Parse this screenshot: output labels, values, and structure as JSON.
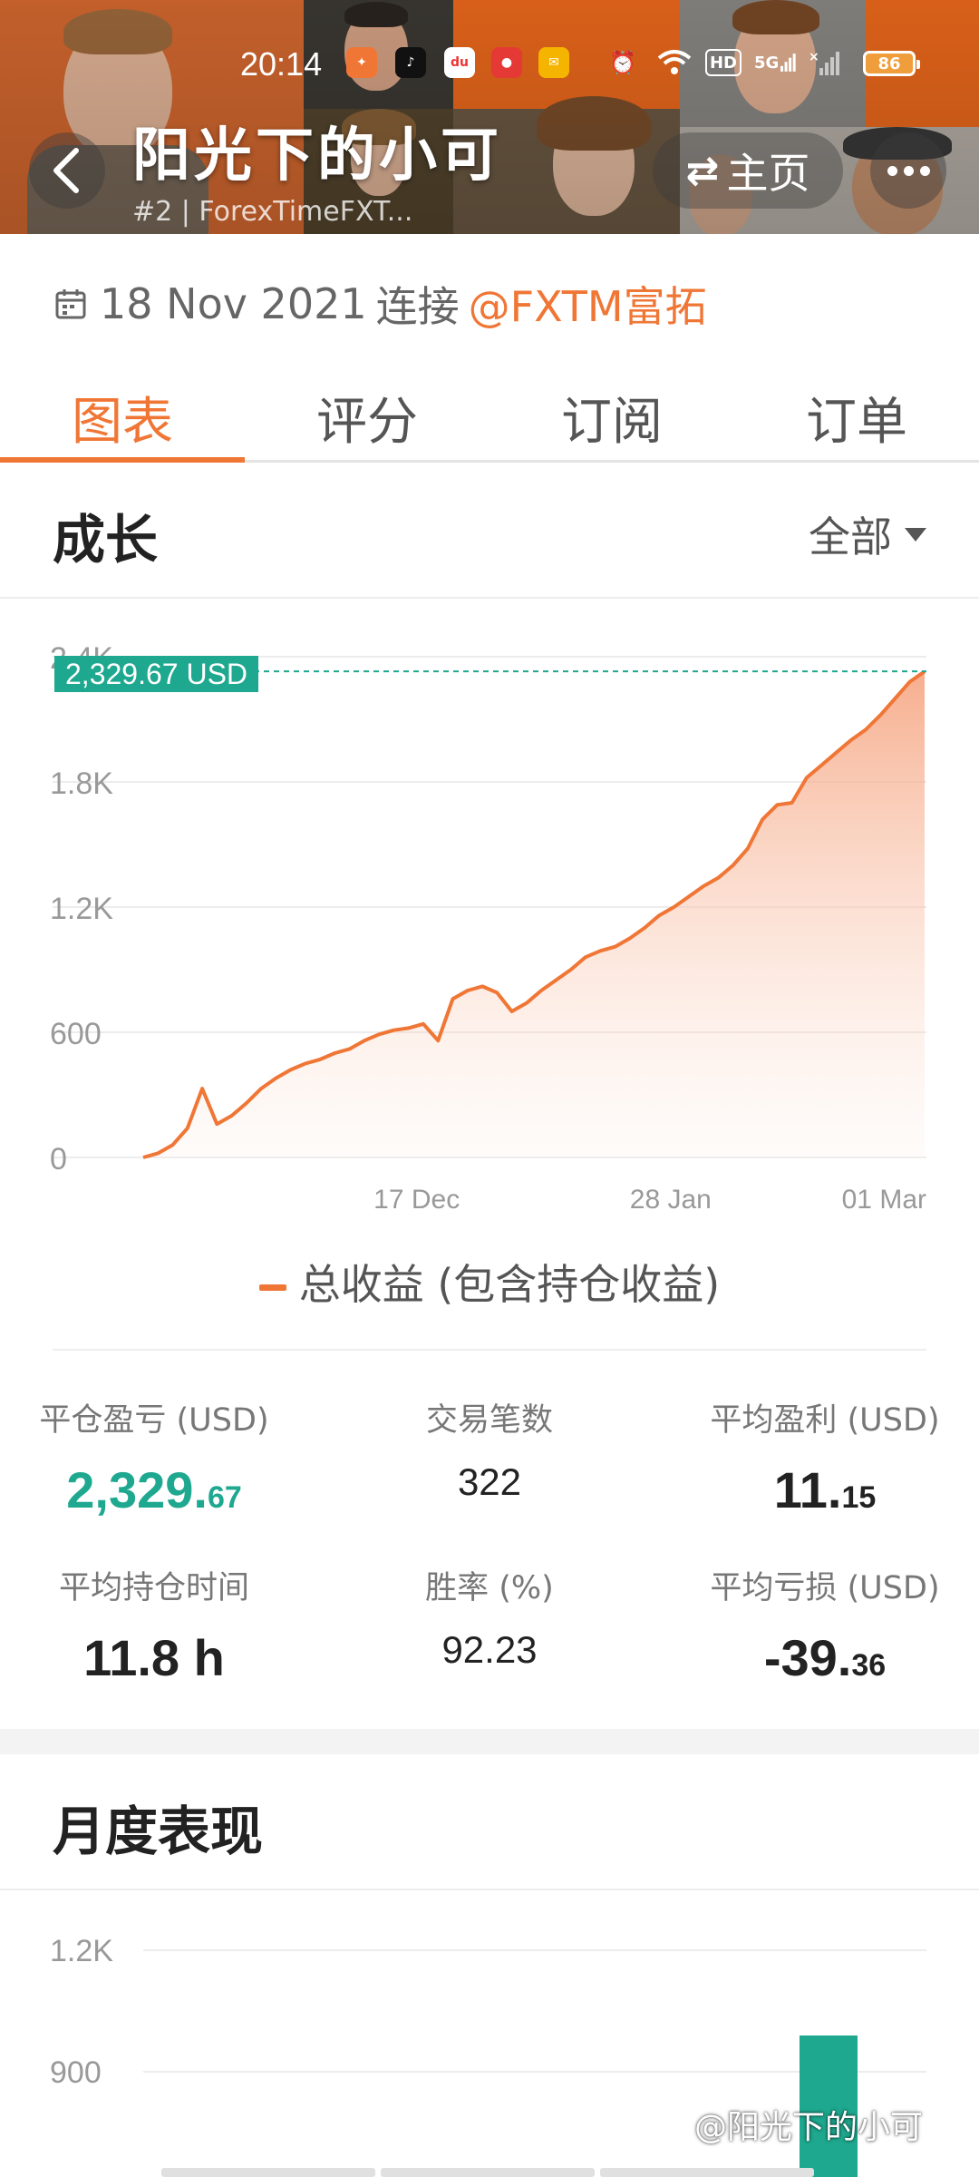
{
  "status_bar": {
    "time": "20:14",
    "network": "5G",
    "hd": "HD",
    "battery": "86"
  },
  "header": {
    "title": "阳光下的小可",
    "subtitle": "#2 | ForexTimeFXT...",
    "home_label": "主页",
    "back_icon": "chevron-left-icon",
    "more_icon": "more-dots-icon"
  },
  "connect": {
    "date": "18 Nov 2021",
    "verb": "连接",
    "broker": "@FXTM富拓"
  },
  "tabs": [
    {
      "label": "图表",
      "active": true
    },
    {
      "label": "评分",
      "active": false
    },
    {
      "label": "订阅",
      "active": false
    },
    {
      "label": "订单",
      "active": false
    }
  ],
  "growth": {
    "title": "成长",
    "range": "全部",
    "current_label": "2,329.67 USD",
    "legend": "总收益 (包含持仓收益)"
  },
  "stats": {
    "closed_pnl": {
      "label": "平仓盈亏 (USD)",
      "int": "2,329.",
      "dec": "67"
    },
    "trades": {
      "label": "交易笔数",
      "value": "322"
    },
    "avg_profit": {
      "label": "平均盈利 (USD)",
      "int": "11.",
      "dec": "15"
    },
    "avg_hold": {
      "label": "平均持仓时间",
      "value": "11.8 h"
    },
    "win_rate": {
      "label": "胜率 (%)",
      "value": "92.23"
    },
    "avg_loss": {
      "label": "平均亏损 (USD)",
      "int": "-39.",
      "dec": "36"
    }
  },
  "monthly": {
    "title": "月度表现"
  },
  "watermark": "@阳光下的小可",
  "colors": {
    "accent": "#f07636",
    "positive": "#1ea88f",
    "text": "#222222"
  },
  "chart_data": [
    {
      "type": "area",
      "title": "",
      "x_labels": [
        "17 Dec",
        "28 Jan",
        "01 Mar"
      ],
      "y_ticks": [
        "0",
        "600",
        "1.2K",
        "1.8K",
        "2.4K"
      ],
      "ylim": [
        0,
        2400
      ],
      "grid": true,
      "legend_position": "bottom",
      "series": [
        {
          "name": "总收益 (包含持仓收益)",
          "color": "#f07636",
          "values": [
            0,
            20,
            60,
            140,
            330,
            160,
            200,
            260,
            330,
            380,
            420,
            450,
            470,
            500,
            520,
            560,
            590,
            610,
            620,
            640,
            560,
            760,
            800,
            820,
            790,
            700,
            740,
            800,
            850,
            900,
            960,
            990,
            1010,
            1050,
            1100,
            1160,
            1200,
            1250,
            1300,
            1340,
            1400,
            1480,
            1620,
            1690,
            1700,
            1820,
            1880,
            1940,
            2000,
            2050,
            2120,
            2200,
            2280,
            2329.67
          ]
        }
      ],
      "current_value_label": "2,329.67 USD"
    },
    {
      "type": "bar",
      "title": "",
      "y_ticks": [
        "900",
        "1.2K"
      ],
      "grid": true,
      "series": [
        {
          "name": "",
          "color": "#1ea88f",
          "values": [
            null,
            null,
            null,
            900
          ]
        }
      ]
    }
  ]
}
